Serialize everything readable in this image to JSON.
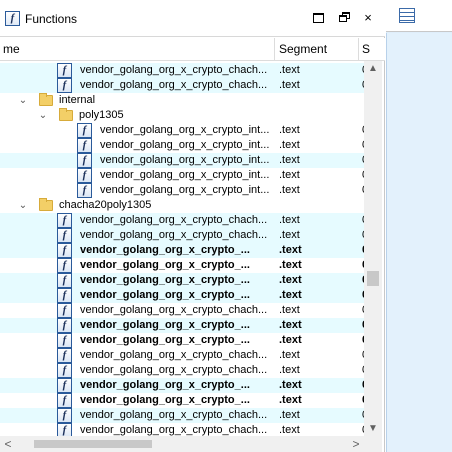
{
  "window": {
    "title": "Functions",
    "title_icon": "function-icon"
  },
  "title_buttons": {
    "maximize": "maximize-icon",
    "restore": "restore-icon",
    "close": "×"
  },
  "columns": {
    "name": "me",
    "segment": "Segment",
    "s": "S"
  },
  "rows": [
    {
      "kind": "fn",
      "depth": 2,
      "name": "vendor_golang_org_x_crypto_chach...",
      "segment": ".text",
      "s": "0",
      "bold": false,
      "hl": true
    },
    {
      "kind": "fn",
      "depth": 2,
      "name": "vendor_golang_org_x_crypto_chach...",
      "segment": ".text",
      "s": "0",
      "bold": false,
      "hl": true
    },
    {
      "kind": "folder",
      "depth": 1,
      "name": "internal",
      "expanded": true
    },
    {
      "kind": "folder",
      "depth": 2,
      "name": "poly1305",
      "expanded": true
    },
    {
      "kind": "fn",
      "depth": 3,
      "name": "vendor_golang_org_x_crypto_int...",
      "segment": ".text",
      "s": "0",
      "bold": false,
      "hl": false
    },
    {
      "kind": "fn",
      "depth": 3,
      "name": "vendor_golang_org_x_crypto_int...",
      "segment": ".text",
      "s": "0",
      "bold": false,
      "hl": false
    },
    {
      "kind": "fn",
      "depth": 3,
      "name": "vendor_golang_org_x_crypto_int...",
      "segment": ".text",
      "s": "0",
      "bold": false,
      "hl": true
    },
    {
      "kind": "fn",
      "depth": 3,
      "name": "vendor_golang_org_x_crypto_int...",
      "segment": ".text",
      "s": "0",
      "bold": false,
      "hl": false
    },
    {
      "kind": "fn",
      "depth": 3,
      "name": "vendor_golang_org_x_crypto_int...",
      "segment": ".text",
      "s": "0",
      "bold": false,
      "hl": false
    },
    {
      "kind": "folder",
      "depth": 1,
      "name": "chacha20poly1305",
      "expanded": true
    },
    {
      "kind": "fn",
      "depth": 2,
      "name": "vendor_golang_org_x_crypto_chach...",
      "segment": ".text",
      "s": "0",
      "bold": false,
      "hl": true
    },
    {
      "kind": "fn",
      "depth": 2,
      "name": "vendor_golang_org_x_crypto_chach...",
      "segment": ".text",
      "s": "0",
      "bold": false,
      "hl": true
    },
    {
      "kind": "fn",
      "depth": 2,
      "name": "vendor_golang_org_x_crypto_...",
      "segment": ".text",
      "s": "0",
      "bold": true,
      "hl": true
    },
    {
      "kind": "fn",
      "depth": 2,
      "name": "vendor_golang_org_x_crypto_...",
      "segment": ".text",
      "s": "0",
      "bold": true,
      "hl": false
    },
    {
      "kind": "fn",
      "depth": 2,
      "name": "vendor_golang_org_x_crypto_...",
      "segment": ".text",
      "s": "0",
      "bold": true,
      "hl": true
    },
    {
      "kind": "fn",
      "depth": 2,
      "name": "vendor_golang_org_x_crypto_...",
      "segment": ".text",
      "s": "0",
      "bold": true,
      "hl": true
    },
    {
      "kind": "fn",
      "depth": 2,
      "name": "vendor_golang_org_x_crypto_chach...",
      "segment": ".text",
      "s": "0",
      "bold": false,
      "hl": false
    },
    {
      "kind": "fn",
      "depth": 2,
      "name": "vendor_golang_org_x_crypto_...",
      "segment": ".text",
      "s": "0",
      "bold": true,
      "hl": true
    },
    {
      "kind": "fn",
      "depth": 2,
      "name": "vendor_golang_org_x_crypto_...",
      "segment": ".text",
      "s": "0",
      "bold": true,
      "hl": false
    },
    {
      "kind": "fn",
      "depth": 2,
      "name": "vendor_golang_org_x_crypto_chach...",
      "segment": ".text",
      "s": "0",
      "bold": false,
      "hl": false
    },
    {
      "kind": "fn",
      "depth": 2,
      "name": "vendor_golang_org_x_crypto_chach...",
      "segment": ".text",
      "s": "0",
      "bold": false,
      "hl": false
    },
    {
      "kind": "fn",
      "depth": 2,
      "name": "vendor_golang_org_x_crypto_...",
      "segment": ".text",
      "s": "0",
      "bold": true,
      "hl": true
    },
    {
      "kind": "fn",
      "depth": 2,
      "name": "vendor_golang_org_x_crypto_...",
      "segment": ".text",
      "s": "0",
      "bold": true,
      "hl": false
    },
    {
      "kind": "fn",
      "depth": 2,
      "name": "vendor_golang_org_x_crypto_chach...",
      "segment": ".text",
      "s": "0",
      "bold": false,
      "hl": true
    },
    {
      "kind": "fn",
      "depth": 2,
      "name": "vendor_golang_org_x_crypto_chach...",
      "segment": ".text",
      "s": "0",
      "bold": false,
      "hl": false
    }
  ],
  "icons": {
    "function": "function-icon",
    "folder": "folder-icon",
    "expand": "chevron-down-icon",
    "grid": "table-grid-icon"
  },
  "scrollbars": {
    "up": "▲",
    "down": "▼",
    "left": "<",
    "right": ">"
  }
}
